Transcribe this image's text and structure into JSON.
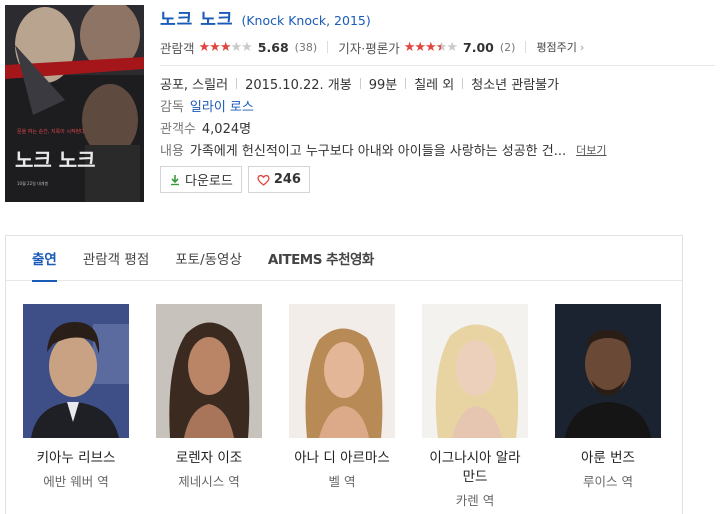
{
  "movie": {
    "title": "노크 노크",
    "subtitle": "(Knock Knock, 2015)"
  },
  "ratings": {
    "audience_label": "관람객",
    "audience_stars": 3,
    "audience_score": "5.68",
    "audience_count": "(38)",
    "critic_label": "기자·평론가",
    "critic_stars": 3.5,
    "critic_score": "7.00",
    "critic_count": "(2)",
    "more_label": "평점주기"
  },
  "meta": {
    "genre": "공포, 스릴러",
    "release": "2015.10.22. 개봉",
    "runtime": "99분",
    "country": "칠레 외",
    "grade": "청소년 관람불가",
    "director_label": "감독",
    "director": "일라이 로스",
    "audience_count_label": "관객수",
    "audience_total": "4,024명",
    "plot_label": "내용",
    "plot": "가족에게 헌신적이고 누구보다 아내와 아이들을 사랑하는 성공한 건...",
    "more_label": "더보기"
  },
  "buttons": {
    "download": "다운로드",
    "likes": "246"
  },
  "tabs": [
    {
      "label": "출연"
    },
    {
      "label": "관람객 평점"
    },
    {
      "label": "포토/동영상"
    },
    {
      "label": "AITEMS 추천영화"
    }
  ],
  "cast": [
    {
      "name": "키아누 리브스",
      "role": "에반 웨버 역"
    },
    {
      "name": "로렌자 이조",
      "role": "제네시스 역"
    },
    {
      "name": "아나 디 아르마스",
      "role": "벨 역"
    },
    {
      "name": "이그나시아 알라만드",
      "name_line1": "이그나시아 알라",
      "name_line2": "만드",
      "role": "카렌 역"
    },
    {
      "name": "아룬 번즈",
      "role": "루이스 역"
    }
  ],
  "colors": {
    "accent": "#1a5bb8",
    "star": "#e0453e",
    "star_off": "#c9c9c9",
    "download_icon": "#3a9a3a"
  }
}
